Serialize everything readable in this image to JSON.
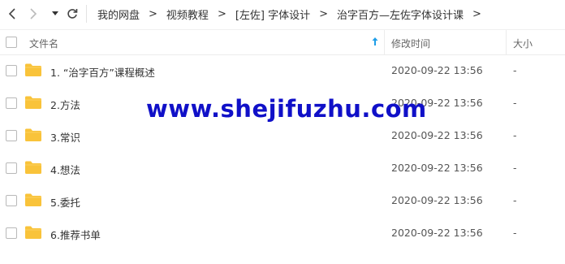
{
  "breadcrumb": [
    "我的网盘",
    "视频教程",
    "[左佐] 字体设计",
    "治字百方—左佐字体设计课"
  ],
  "breadcrumb_separator": ">",
  "nav": {
    "back_icon": "chevron-left-icon",
    "forward_icon": "chevron-right-icon",
    "dropdown_icon": "caret-down-icon",
    "refresh_icon": "refresh-icon"
  },
  "table": {
    "columns": {
      "name": "文件名",
      "modified": "修改时间",
      "size": "大小"
    },
    "sort_icon": "sort-arrow-up-icon",
    "rows": [
      {
        "name": "1. “治字百方”课程概述",
        "modified": "2020-09-22 13:56",
        "size": "-"
      },
      {
        "name": "2.方法",
        "modified": "2020-09-22 13:56",
        "size": "-"
      },
      {
        "name": "3.常识",
        "modified": "2020-09-22 13:56",
        "size": "-"
      },
      {
        "name": "4.想法",
        "modified": "2020-09-22 13:56",
        "size": "-"
      },
      {
        "name": "5.委托",
        "modified": "2020-09-22 13:56",
        "size": "-"
      },
      {
        "name": "6.推荐书单",
        "modified": "2020-09-22 13:56",
        "size": "-"
      }
    ]
  },
  "watermark": "www.shejifuzhu.com",
  "colors": {
    "folder": "#f9c33a",
    "sort_arrow": "#1f9ee8",
    "watermark": "#1010c8"
  }
}
